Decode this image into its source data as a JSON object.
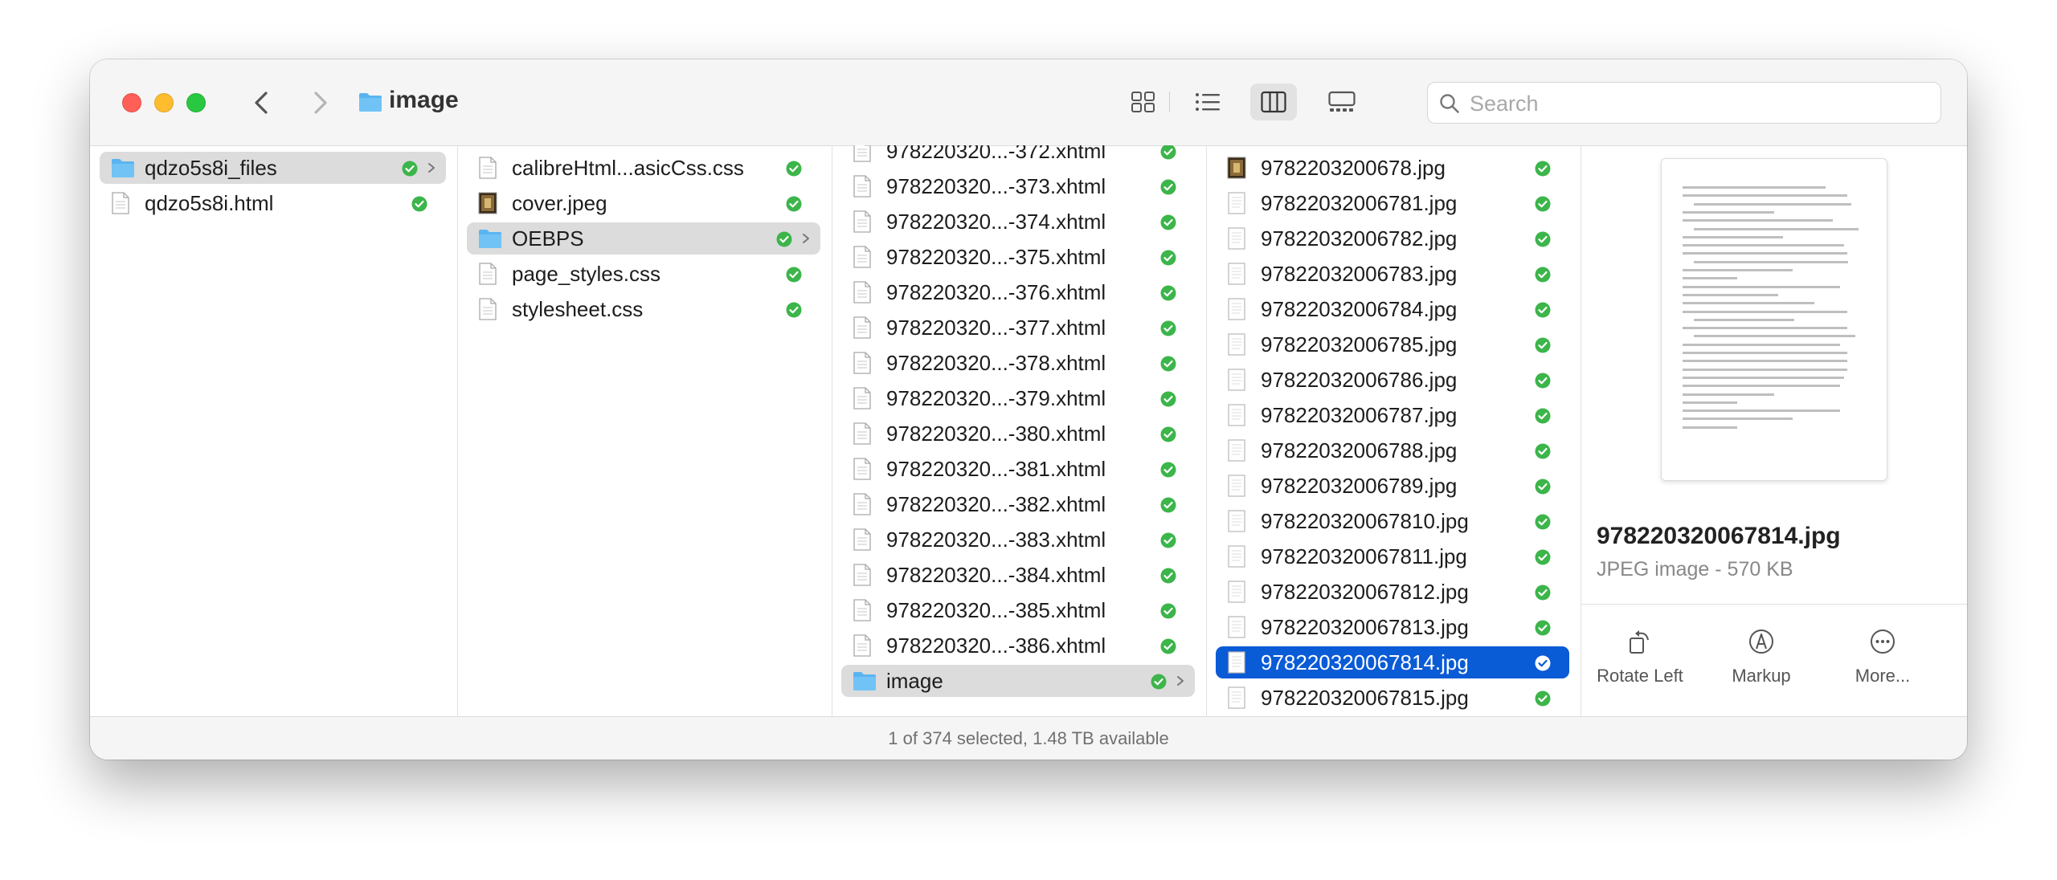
{
  "window": {
    "title": "image"
  },
  "search": {
    "placeholder": "Search"
  },
  "columns": {
    "col1": [
      {
        "name": "qdzo5s8i_files",
        "kind": "folder",
        "selected": "gray",
        "chevron": true
      },
      {
        "name": "qdzo5s8i.html",
        "kind": "doc"
      }
    ],
    "col2": [
      {
        "name": "calibreHtml...asicCss.css",
        "kind": "doc"
      },
      {
        "name": "cover.jpeg",
        "kind": "image"
      },
      {
        "name": "OEBPS",
        "kind": "folder",
        "selected": "gray",
        "chevron": true
      },
      {
        "name": "page_styles.css",
        "kind": "doc"
      },
      {
        "name": "stylesheet.css",
        "kind": "doc"
      }
    ],
    "col3": [
      {
        "name": "978220320...-372.xhtml",
        "kind": "doc"
      },
      {
        "name": "978220320...-373.xhtml",
        "kind": "doc"
      },
      {
        "name": "978220320...-374.xhtml",
        "kind": "doc"
      },
      {
        "name": "978220320...-375.xhtml",
        "kind": "doc"
      },
      {
        "name": "978220320...-376.xhtml",
        "kind": "doc"
      },
      {
        "name": "978220320...-377.xhtml",
        "kind": "doc"
      },
      {
        "name": "978220320...-378.xhtml",
        "kind": "doc"
      },
      {
        "name": "978220320...-379.xhtml",
        "kind": "doc"
      },
      {
        "name": "978220320...-380.xhtml",
        "kind": "doc"
      },
      {
        "name": "978220320...-381.xhtml",
        "kind": "doc"
      },
      {
        "name": "978220320...-382.xhtml",
        "kind": "doc"
      },
      {
        "name": "978220320...-383.xhtml",
        "kind": "doc"
      },
      {
        "name": "978220320...-384.xhtml",
        "kind": "doc"
      },
      {
        "name": "978220320...-385.xhtml",
        "kind": "doc"
      },
      {
        "name": "978220320...-386.xhtml",
        "kind": "doc"
      },
      {
        "name": "image",
        "kind": "folder",
        "selected": "gray",
        "chevron": true
      }
    ],
    "col4": [
      {
        "name": "9782203200678.jpg",
        "kind": "image"
      },
      {
        "name": "97822032006781.jpg",
        "kind": "thumb"
      },
      {
        "name": "97822032006782.jpg",
        "kind": "thumb"
      },
      {
        "name": "97822032006783.jpg",
        "kind": "thumb"
      },
      {
        "name": "97822032006784.jpg",
        "kind": "thumb"
      },
      {
        "name": "97822032006785.jpg",
        "kind": "thumb"
      },
      {
        "name": "97822032006786.jpg",
        "kind": "thumb"
      },
      {
        "name": "97822032006787.jpg",
        "kind": "thumb"
      },
      {
        "name": "97822032006788.jpg",
        "kind": "thumb"
      },
      {
        "name": "97822032006789.jpg",
        "kind": "thumb"
      },
      {
        "name": "978220320067810.jpg",
        "kind": "thumb"
      },
      {
        "name": "978220320067811.jpg",
        "kind": "thumb"
      },
      {
        "name": "978220320067812.jpg",
        "kind": "thumb"
      },
      {
        "name": "978220320067813.jpg",
        "kind": "thumb"
      },
      {
        "name": "978220320067814.jpg",
        "kind": "thumb",
        "selected": "blue"
      },
      {
        "name": "978220320067815.jpg",
        "kind": "thumb"
      }
    ]
  },
  "preview": {
    "filename": "978220320067814.jpg",
    "kind_size": "JPEG image - 570 KB",
    "actions": {
      "rotate_left": "Rotate Left",
      "markup": "Markup",
      "more": "More..."
    }
  },
  "status": {
    "text": "1 of 374 selected, 1.48 TB available"
  },
  "colors": {
    "accent": "#0a5bd6",
    "sync_check": "#3cb54a",
    "folder": "#5ab4f0",
    "close": "#ff5f57",
    "minimize": "#febc2e",
    "zoom": "#28c840"
  }
}
